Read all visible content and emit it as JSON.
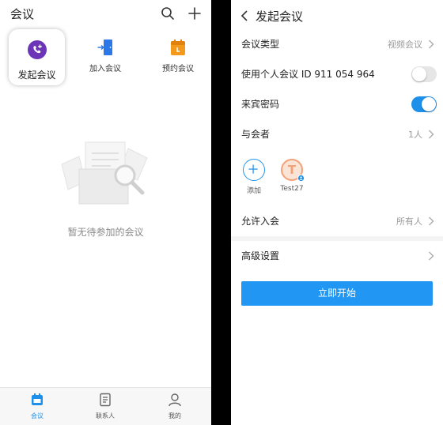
{
  "left": {
    "title": "会议",
    "actions": {
      "start": "发起会议",
      "join": "加入会议",
      "book": "预约会议"
    },
    "empty_text": "暂无待参加的会议",
    "tabs": [
      {
        "label": "会议"
      },
      {
        "label": "联系人"
      },
      {
        "label": "我的"
      }
    ]
  },
  "right": {
    "title": "发起会议",
    "rows": {
      "meeting_type": {
        "label": "会议类型",
        "value": "视频会议"
      },
      "personal_id": {
        "label": "使用个人会议 ID 911 054 964",
        "enabled": false
      },
      "guest_password": {
        "label": "来宾密码",
        "enabled": true
      },
      "participants": {
        "label": "与会者",
        "value": "1人"
      },
      "allow_join": {
        "label": "允许入会",
        "value": "所有人"
      },
      "advanced": {
        "label": "高级设置"
      }
    },
    "participant_items": [
      {
        "label": "添加"
      },
      {
        "label": "Test27",
        "initial": "T"
      }
    ],
    "start_button": "立即开始"
  },
  "colors": {
    "accent": "#1f90ea",
    "start_icon": "#6c35b7",
    "join_icon": "#2c78e6",
    "book_icon": "#f39a1d"
  },
  "icons": {
    "start": "phone-plus-icon",
    "join": "door-enter-icon",
    "book": "calendar-icon"
  }
}
